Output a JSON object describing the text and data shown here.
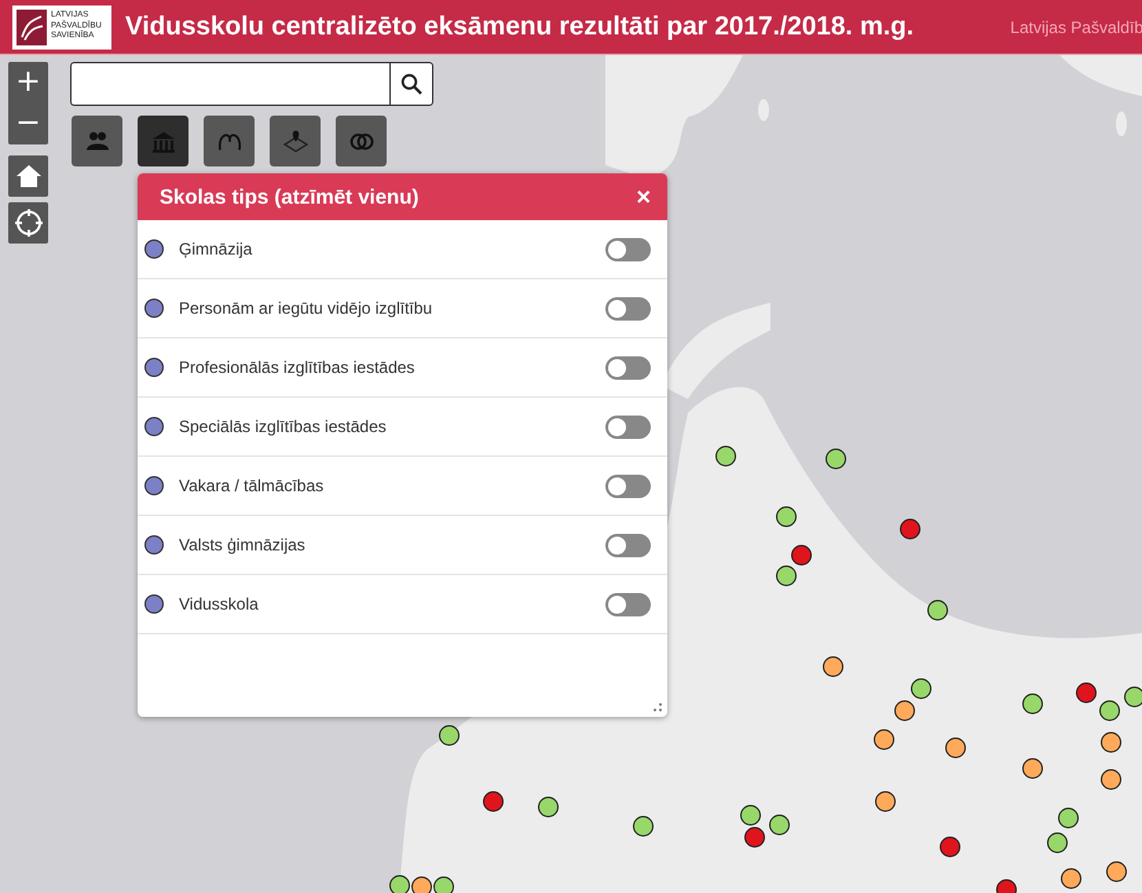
{
  "header": {
    "logo_lines": [
      "LATVIJAS",
      "PAŠVALDĪBU",
      "SAVIENĪBA"
    ],
    "title": "Vidusskolu centralizēto eksāmenu rezultāti par 2017./2018. m.g.",
    "org": "Latvijas Pašvaldīb"
  },
  "zoom": {
    "in": "+",
    "out": "−"
  },
  "tools": [
    {
      "kind": "people",
      "selected": false
    },
    {
      "kind": "school",
      "selected": true
    },
    {
      "kind": "heads",
      "selected": false
    },
    {
      "kind": "map",
      "selected": false
    },
    {
      "kind": "rings",
      "selected": false
    }
  ],
  "panel": {
    "title": "Skolas tips (atzīmēt vienu)",
    "close": "×",
    "items": [
      {
        "label": "Ģimnāzija",
        "on": false
      },
      {
        "label": "Personām ar iegūtu vidējo izglītību",
        "on": false
      },
      {
        "label": "Profesionālās izglītības iestādes",
        "on": false
      },
      {
        "label": "Speciālās izglītības iestādes",
        "on": false
      },
      {
        "label": "Vakara / tālmācības",
        "on": false
      },
      {
        "label": "Valsts ģimnāzijas",
        "on": false
      },
      {
        "label": "Vidusskola",
        "on": false
      }
    ]
  },
  "map": {
    "markers": [
      {
        "color": "#98d86a"
      },
      {
        "color": "#98d86a"
      },
      {
        "color": "#98d86a"
      },
      {
        "color": "#98d86a"
      },
      {
        "color": "#98d86a"
      },
      {
        "color": "#e0141c"
      },
      {
        "color": "#e0141c"
      },
      {
        "color": "#ffaa5a"
      },
      {
        "color": "#ffaa5a"
      },
      {
        "color": "#98d86a"
      },
      {
        "color": "#ffaa5a"
      },
      {
        "color": "#ffaa5a"
      },
      {
        "color": "#ffaa5a"
      },
      {
        "color": "#ffaa5a"
      },
      {
        "color": "#98d86a"
      },
      {
        "color": "#e0141c"
      },
      {
        "color": "#98d86a"
      },
      {
        "color": "#98d86a"
      },
      {
        "color": "#ffaa5a"
      },
      {
        "color": "#ffaa5a"
      },
      {
        "color": "#ffaa5a"
      },
      {
        "color": "#98d86a"
      },
      {
        "color": "#98d86a"
      },
      {
        "color": "#e0141c"
      },
      {
        "color": "#98d86a"
      },
      {
        "color": "#98d86a"
      },
      {
        "color": "#ffaa5a"
      },
      {
        "color": "#e0141c"
      },
      {
        "color": "#e0141c"
      },
      {
        "color": "#98d86a"
      },
      {
        "color": "#98d86a"
      },
      {
        "color": "#98d86a"
      },
      {
        "color": "#e0141c"
      },
      {
        "color": "#98d86a"
      },
      {
        "color": "#ffaa5a"
      },
      {
        "color": "#98d86a"
      }
    ]
  }
}
